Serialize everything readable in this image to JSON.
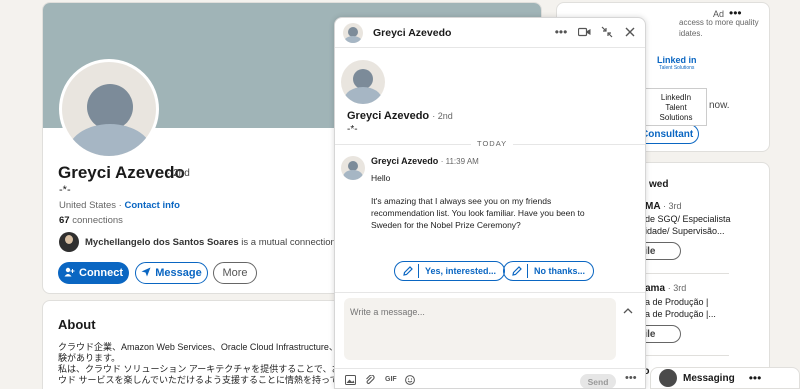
{
  "profile": {
    "name": "Greyci Azevedo",
    "degree": "· 2nd",
    "headline": "-*-",
    "location": "United States · ",
    "contact_link": "Contact info",
    "connections_count": "67",
    "connections_label": " connections",
    "mutual_name": "Mychellangelo dos Santos Soares",
    "mutual_suffix": " is a mutual connection",
    "buttons": {
      "connect": "Connect",
      "message": "Message",
      "more": "More"
    }
  },
  "about": {
    "title": "About",
    "lines": [
      "クラウド企業、Amazon Web Services、Oracle Cloud Infrastructure、お",
      "験があります。",
      "私は、クラウド ソリューション アーキテクチャを提供することで、お",
      "ウド サービスを楽しんでいただけるよう支援することに情熱を持って"
    ]
  },
  "ad": {
    "label": "Ad",
    "text_1": "access to more quality",
    "text_2": "idates.",
    "logo_main": "Linked in",
    "logo_sub": "Talent Solutions",
    "now_text": "now.",
    "button": "Consultant",
    "tooltip_lines": [
      "LinkedIn",
      "Talent",
      "Solutions"
    ]
  },
  "viewed": {
    "title": "wed",
    "people": [
      {
        "name": "MA",
        "degree": "· 3rd",
        "line1": "de SGQ/ Especialista",
        "line2": "idade/ Supervisão...",
        "button": "rofile"
      },
      {
        "name": "ama",
        "degree": "· 3rd",
        "line1": "a de Produção |",
        "line2": "a de Produção |...",
        "button": "rofile"
      }
    ],
    "bottom_name": "to"
  },
  "messaging_bar": {
    "label": "Messaging"
  },
  "chat": {
    "header_name": "Greyci Azevedo",
    "name": "Greyci Azevedo",
    "degree": "· 2nd",
    "subtitle": "-*-",
    "date_divider": "TODAY",
    "sender": "Greyci Azevedo",
    "time": "· 11:39 AM",
    "message_lines": [
      "Hello",
      "It's amazing that I always see you on my friends",
      "recommendation list. You look familiar. Have you been to",
      "Sweden for the Nobel Prize Ceremony?"
    ],
    "replies": [
      "Yes, interested...",
      "No thanks..."
    ],
    "compose_placeholder": "Write a message...",
    "send_label": "Send",
    "gif_label": "GIF"
  },
  "colors": {
    "accent": "#0a66c2",
    "banner": "#a0b4b7",
    "page_bg": "#f4f2ee"
  }
}
